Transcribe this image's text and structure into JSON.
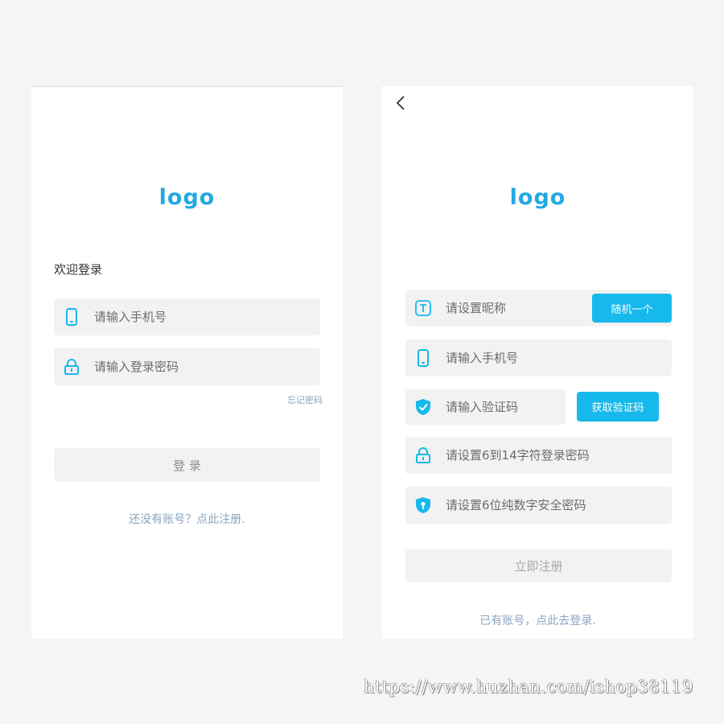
{
  "colors": {
    "accent": "#17b8eb",
    "logo": "#23a9e1",
    "field_bg": "#f2f2f2",
    "link": "#8aa3bf"
  },
  "login": {
    "logo": "logo",
    "welcome": "欢迎登录",
    "phone": {
      "icon": "phone-icon",
      "placeholder": "请输入手机号"
    },
    "password": {
      "icon": "lock-icon",
      "placeholder": "请输入登录密码"
    },
    "forgot_link": "忘记密码",
    "submit_label": "登 录",
    "register_link": "还没有账号？点此注册."
  },
  "register": {
    "back_icon": "chevron-left-icon",
    "logo": "logo",
    "nickname": {
      "icon": "text-t-icon",
      "placeholder": "请设置昵称",
      "button": "随机一个"
    },
    "phone": {
      "icon": "phone-icon",
      "placeholder": "请输入手机号"
    },
    "code": {
      "icon": "shield-check-icon",
      "placeholder": "请输入验证码",
      "button": "获取验证码"
    },
    "password": {
      "icon": "lock-icon",
      "placeholder": "请设置6到14字符登录密码"
    },
    "security_password": {
      "icon": "shield-icon",
      "placeholder": "请设置6位纯数字安全密码"
    },
    "submit_label": "立即注册",
    "login_link": "已有账号，点此去登录."
  },
  "watermark": "https://www.huzhan.com/ishop38119"
}
